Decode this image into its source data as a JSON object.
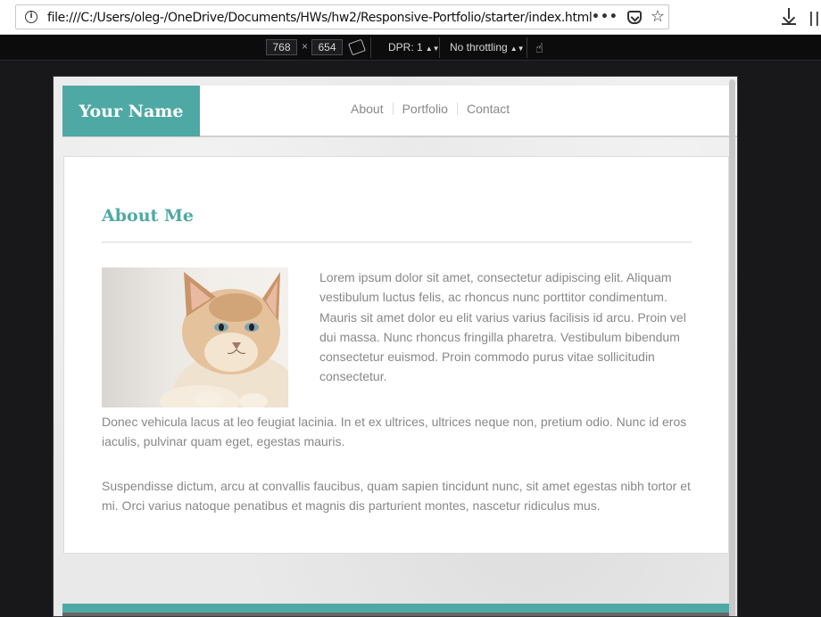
{
  "browser": {
    "url": "file:///C:/Users/oleg-/OneDrive/Documents/HWs/hw2/Responsive-Portfolio/starter/index.html",
    "icons": [
      "info-icon",
      "page-actions-icon",
      "pocket-icon",
      "bookmark-star-icon",
      "download-icon",
      "library-icon"
    ]
  },
  "devtools": {
    "width": "768",
    "x_label": "×",
    "height": "654",
    "dpr_label": "DPR: 1",
    "throttling_label": "No throttling"
  },
  "site": {
    "logo": "Your Name",
    "nav": [
      "About",
      "Portfolio",
      "Contact"
    ],
    "section_title": "About Me",
    "image_alt": "cat",
    "paragraphs": [
      "Lorem ipsum dolor sit amet, consectetur adipiscing elit. Aliquam vestibulum luctus felis, ac rhoncus nunc porttitor condimentum. Mauris sit amet dolor eu elit varius varius facilisis id arcu. Proin vel dui massa. Nunc rhoncus fringilla pharetra. Vestibulum bibendum consectetur euismod. Proin commodo purus vitae sollicitudin consectetur.",
      "Donec vehicula lacus at leo feugiat lacinia. In et ex ultrices, ultrices neque non, pretium odio. Nunc id eros iaculis, pulvinar quam eget, egestas mauris.",
      "Suspendisse dictum, arcu at convallis faucibus, quam sapien tincidunt nunc, sit amet egestas nibh tortor et mi. Orci varius natoque penatibus et magnis dis parturient montes, nascetur ridiculus mus."
    ]
  },
  "colors": {
    "accent": "#4ea9a4",
    "body_text": "#888888",
    "devtools_bg": "#0c0c0d"
  }
}
